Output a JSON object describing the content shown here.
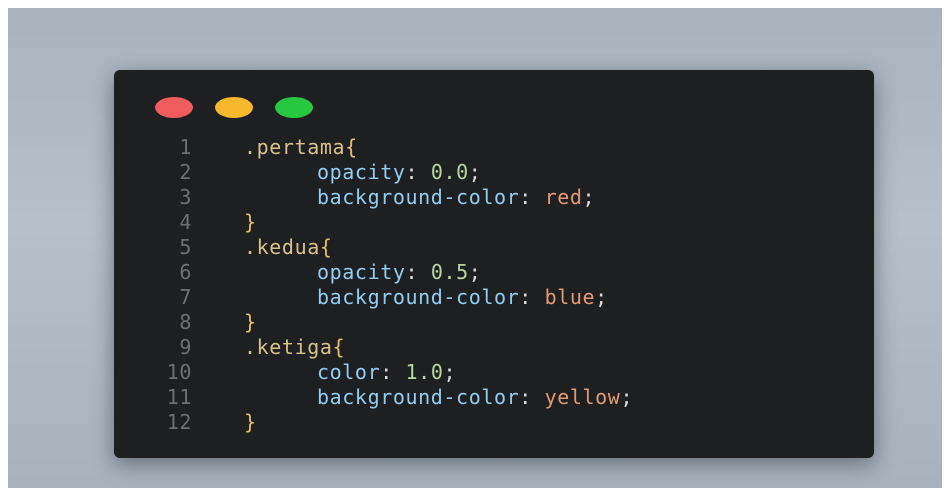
{
  "window": {
    "controls": [
      {
        "name": "close",
        "color": "#f05d5c"
      },
      {
        "name": "minimize",
        "color": "#f9b82c"
      },
      {
        "name": "maximize",
        "color": "#27c73f"
      }
    ]
  },
  "code": {
    "lines": [
      {
        "num": "1",
        "sel": ".pertama",
        "brace": "{"
      },
      {
        "num": "2",
        "prop": "opacity",
        "colon": ":",
        "value": "0.0",
        "semi": ";",
        "kind": "num"
      },
      {
        "num": "3",
        "prop": "background-color",
        "colon": ":",
        "value": "red",
        "semi": ";",
        "kind": "val"
      },
      {
        "num": "4",
        "brace": "}"
      },
      {
        "num": "5",
        "sel": ".kedua",
        "brace": "{"
      },
      {
        "num": "6",
        "prop": "opacity",
        "colon": ":",
        "value": "0.5",
        "semi": ";",
        "kind": "num"
      },
      {
        "num": "7",
        "prop": "background-color",
        "colon": ":",
        "value": "blue",
        "semi": ";",
        "kind": "val"
      },
      {
        "num": "8",
        "brace": "}"
      },
      {
        "num": "9",
        "sel": ".ketiga",
        "brace": "{"
      },
      {
        "num": "10",
        "prop": "color",
        "colon": ":",
        "value": "1.0",
        "semi": ";",
        "kind": "num"
      },
      {
        "num": "11",
        "prop": "background-color",
        "colon": ":",
        "value": "yellow",
        "semi": ";",
        "kind": "val"
      },
      {
        "num": "12",
        "brace": "}"
      }
    ]
  }
}
